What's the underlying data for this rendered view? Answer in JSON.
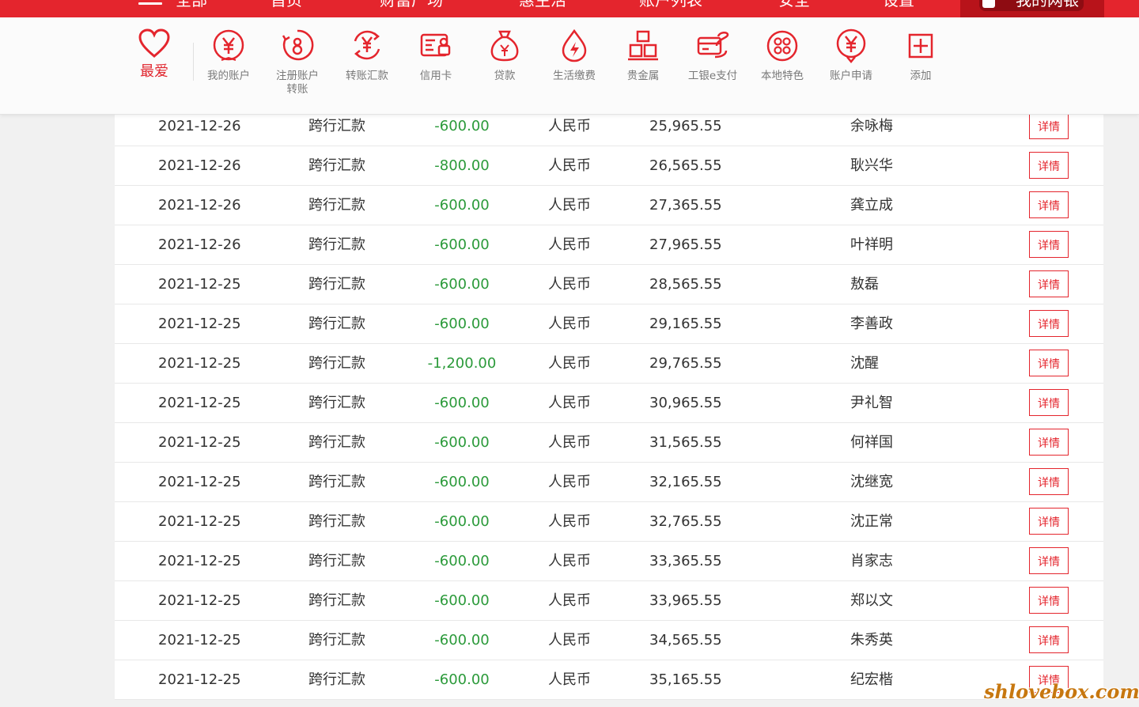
{
  "nav": {
    "items": [
      "全部",
      "首页",
      "财富广场",
      "惠生活",
      "账户列表",
      "安全",
      "设置"
    ],
    "mybank": "我的网银"
  },
  "favorites": {
    "main_label": "最爱",
    "items": [
      {
        "label": "我的账户",
        "icon": "yuan-coin-icon"
      },
      {
        "label": "注册账户\n转账",
        "icon": "transfer-coin-icon"
      },
      {
        "label": "转账汇款",
        "icon": "remittance-icon"
      },
      {
        "label": "信用卡",
        "icon": "credit-card-icon"
      },
      {
        "label": "贷款",
        "icon": "money-bag-icon"
      },
      {
        "label": "生活缴费",
        "icon": "utility-drop-icon"
      },
      {
        "label": "贵金属",
        "icon": "gold-bars-icon"
      },
      {
        "label": "工银e支付",
        "icon": "e-pay-card-icon"
      },
      {
        "label": "本地特色",
        "icon": "local-dots-icon"
      },
      {
        "label": "账户申请",
        "icon": "account-apply-icon"
      },
      {
        "label": "添加",
        "icon": "plus-box-icon"
      }
    ]
  },
  "table": {
    "detail_label": "详情",
    "rows": [
      {
        "date": "2021-12-26",
        "type": "跨行汇款",
        "amount": "-600.00",
        "currency": "人民币",
        "balance": "25,965.55",
        "name": "余咏梅"
      },
      {
        "date": "2021-12-26",
        "type": "跨行汇款",
        "amount": "-800.00",
        "currency": "人民币",
        "balance": "26,565.55",
        "name": "耿兴华"
      },
      {
        "date": "2021-12-26",
        "type": "跨行汇款",
        "amount": "-600.00",
        "currency": "人民币",
        "balance": "27,365.55",
        "name": "龚立成"
      },
      {
        "date": "2021-12-26",
        "type": "跨行汇款",
        "amount": "-600.00",
        "currency": "人民币",
        "balance": "27,965.55",
        "name": "叶祥明"
      },
      {
        "date": "2021-12-25",
        "type": "跨行汇款",
        "amount": "-600.00",
        "currency": "人民币",
        "balance": "28,565.55",
        "name": "敖磊"
      },
      {
        "date": "2021-12-25",
        "type": "跨行汇款",
        "amount": "-600.00",
        "currency": "人民币",
        "balance": "29,165.55",
        "name": "李善政"
      },
      {
        "date": "2021-12-25",
        "type": "跨行汇款",
        "amount": "-1,200.00",
        "currency": "人民币",
        "balance": "29,765.55",
        "name": "沈醒"
      },
      {
        "date": "2021-12-25",
        "type": "跨行汇款",
        "amount": "-600.00",
        "currency": "人民币",
        "balance": "30,965.55",
        "name": "尹礼智"
      },
      {
        "date": "2021-12-25",
        "type": "跨行汇款",
        "amount": "-600.00",
        "currency": "人民币",
        "balance": "31,565.55",
        "name": "何祥国"
      },
      {
        "date": "2021-12-25",
        "type": "跨行汇款",
        "amount": "-600.00",
        "currency": "人民币",
        "balance": "32,165.55",
        "name": "沈继宽"
      },
      {
        "date": "2021-12-25",
        "type": "跨行汇款",
        "amount": "-600.00",
        "currency": "人民币",
        "balance": "32,765.55",
        "name": "沈正常"
      },
      {
        "date": "2021-12-25",
        "type": "跨行汇款",
        "amount": "-600.00",
        "currency": "人民币",
        "balance": "33,365.55",
        "name": "肖家志"
      },
      {
        "date": "2021-12-25",
        "type": "跨行汇款",
        "amount": "-600.00",
        "currency": "人民币",
        "balance": "33,965.55",
        "name": "郑以文"
      },
      {
        "date": "2021-12-25",
        "type": "跨行汇款",
        "amount": "-600.00",
        "currency": "人民币",
        "balance": "34,565.55",
        "name": "朱秀英"
      },
      {
        "date": "2021-12-25",
        "type": "跨行汇款",
        "amount": "-600.00",
        "currency": "人民币",
        "balance": "35,165.55",
        "name": "纪宏楷"
      }
    ]
  },
  "watermark": "shlovebox.com",
  "colors": {
    "brand_red": "#e4252d",
    "amount_green": "#2b9a3a"
  }
}
